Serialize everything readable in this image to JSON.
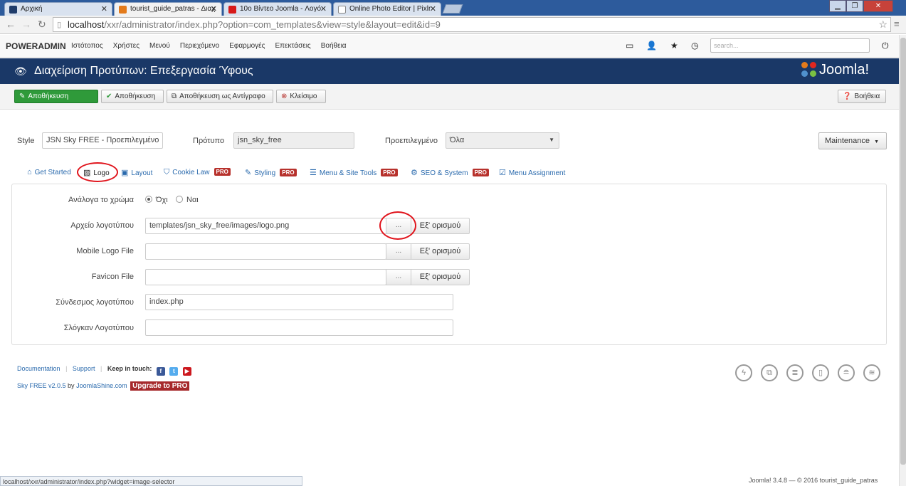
{
  "browser": {
    "tabs": [
      {
        "title": "Αρχική",
        "favicon_color": "#1f3c6b",
        "active": false
      },
      {
        "title": "tourist_guide_patras - Διαχ",
        "favicon_color": "#e37b1c",
        "active": true
      },
      {
        "title": "10ο Βίντεο Joomla - Λογό",
        "favicon_color": "#d71a1a",
        "active": false
      },
      {
        "title": "Online Photo Editor | Pixlr",
        "favicon_color": "#888888",
        "active": false
      }
    ],
    "url_host": "localhost",
    "url_path": "/xxr/administrator/index.php?option=com_templates&view=style&layout=edit&id=9"
  },
  "adminbar": {
    "brand": "POWERADMIN",
    "menu": [
      "Ιστότοπος",
      "Χρήστες",
      "Μενού",
      "Περιεχόμενο",
      "Εφαρμογές",
      "Επεκτάσεις",
      "Βοήθεια"
    ],
    "search_placeholder": "search..."
  },
  "header": {
    "title": "Διαχείριση Προτύπων: Επεξεργασία Ύφους",
    "logo_text": "Joomla!"
  },
  "toolbar": {
    "save": "Αποθήκευση",
    "save2": "Αποθήκευση",
    "save_copy": "Αποθήκευση ως Αντίγραφο",
    "close": "Κλείσιμο",
    "help": "Βοήθεια"
  },
  "style_row": {
    "style_label": "Style",
    "style_value": "JSN Sky FREE - Προεπιλεγμένο",
    "template_label": "Πρότυπο",
    "template_value": "jsn_sky_free",
    "default_label": "Προεπιλεγμένο",
    "default_value": "Όλα",
    "maintenance": "Maintenance"
  },
  "tabs": [
    {
      "label": "Get Started",
      "icon": "home-icon",
      "pro": false
    },
    {
      "label": "Logo",
      "icon": "image-icon",
      "pro": false
    },
    {
      "label": "Layout",
      "icon": "layout-icon",
      "pro": false
    },
    {
      "label": "Cookie Law",
      "icon": "shield-icon",
      "pro": true
    },
    {
      "label": "Styling",
      "icon": "magic-icon",
      "pro": true
    },
    {
      "label": "Menu & Site Tools",
      "icon": "list-icon",
      "pro": true
    },
    {
      "label": "SEO & System",
      "icon": "gear-icon",
      "pro": true
    },
    {
      "label": "Menu Assignment",
      "icon": "checkbox-icon",
      "pro": false
    }
  ],
  "pro_badge": "PRO",
  "form": {
    "color_label": "Ανάλογα το χρώμα",
    "no": "Όχι",
    "yes": "Ναι",
    "logo_file_label": "Αρχείο λογοτύπου",
    "logo_file_value": "templates/jsn_sky_free/images/logo.png",
    "mobile_logo_label": "Mobile Logo File",
    "favicon_label": "Favicon File",
    "logo_link_label": "Σύνδεσμος λογοτύπου",
    "logo_link_value": "index.php",
    "slogan_label": "Σλόγκαν Λογοτύπου",
    "browse": "...",
    "default_button": "Εξ' ορισμού"
  },
  "footer": {
    "documentation": "Documentation",
    "support": "Support",
    "keep_in_touch": "Keep in touch:",
    "version": "Sky FREE v2.0.5",
    "by": "by",
    "author": "JoomlaShine.com",
    "upgrade": "Upgrade to PRO"
  },
  "statusbar": "localhost/xxr/administrator/index.php?widget=image-selector",
  "joomla_version": "Joomla! 3.4.8 — © 2016 tourist_guide_patras"
}
